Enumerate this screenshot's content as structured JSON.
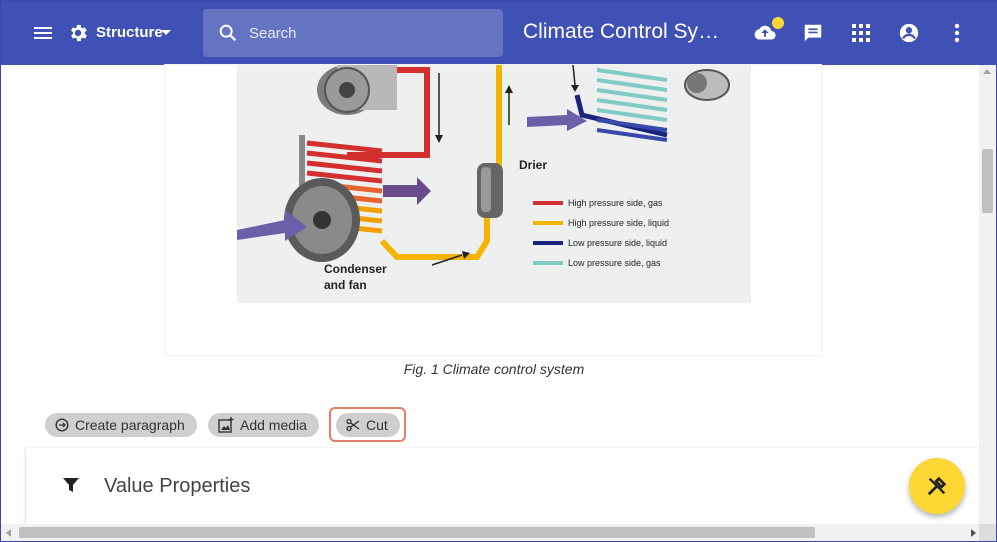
{
  "appbar": {
    "structure_label": "Structure",
    "search_placeholder": "Search",
    "title": "Climate Control System",
    "bg_color": "#3f51b5",
    "icons": [
      "menu-icon",
      "gear-icon",
      "search-icon",
      "cloud-upload-icon",
      "chat-icon",
      "apps-icon",
      "account-circle-icon",
      "more-vert-icon"
    ]
  },
  "figure": {
    "caption": "Fig. 1 Climate control system",
    "labels": {
      "drier": "Drier",
      "condenser_line1": "Condenser",
      "condenser_line2": "and fan"
    },
    "legend": [
      {
        "label": "High pressure side, gas",
        "color": "#d32f2f"
      },
      {
        "label": "High pressure side, liquid",
        "color": "#f4b400"
      },
      {
        "label": "Low pressure side, liquid",
        "color": "#1a237e"
      },
      {
        "label": "Low pressure side, gas",
        "color": "#80cbc4"
      }
    ]
  },
  "toolbar": {
    "create_paragraph": "Create paragraph",
    "add_media": "Add media",
    "cut": "Cut"
  },
  "panel": {
    "title": "Value Properties"
  },
  "fab": {
    "icon": "tools-icon",
    "color": "#fdd835"
  }
}
